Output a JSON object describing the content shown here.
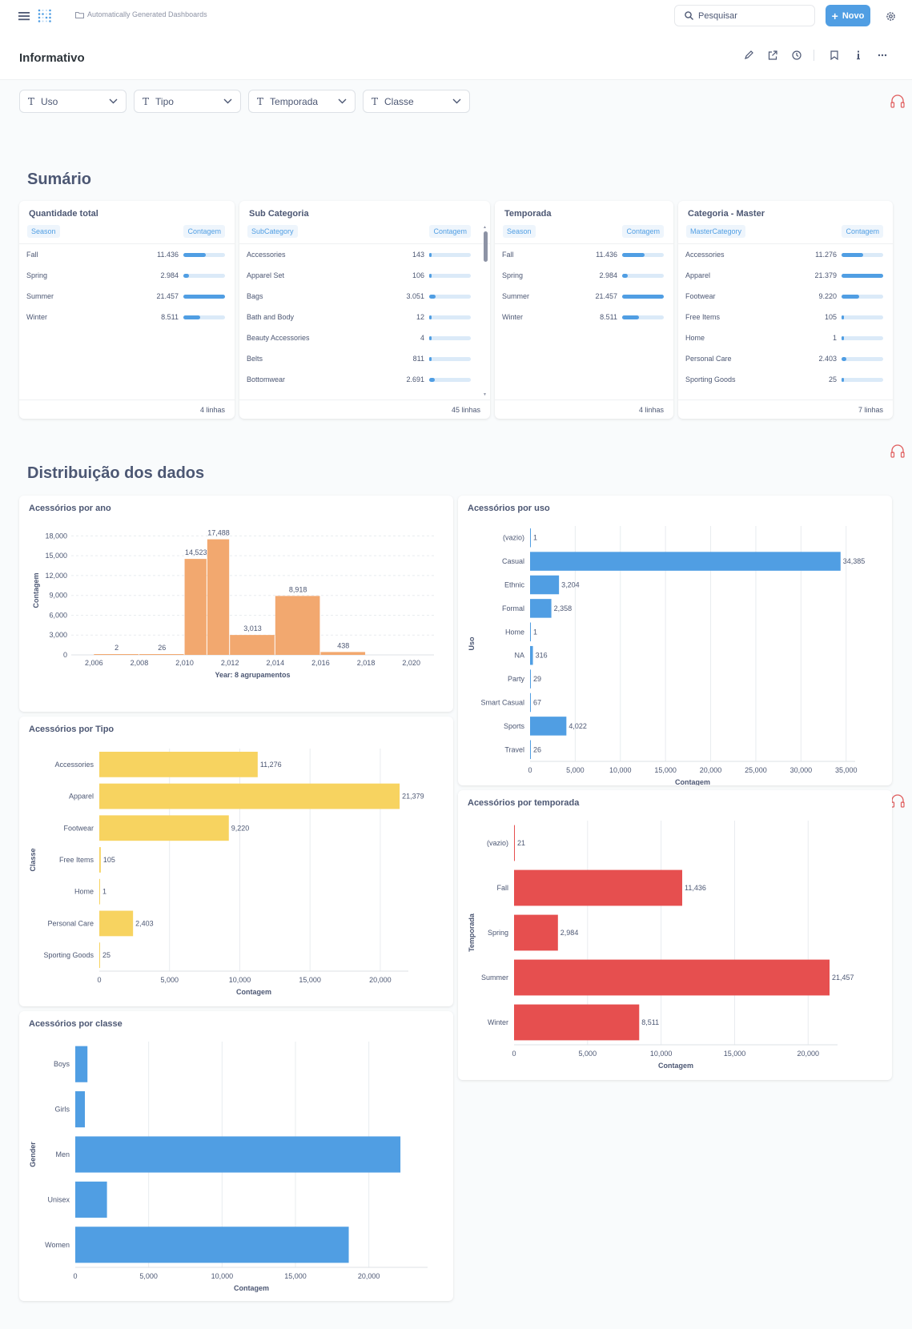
{
  "topbar": {
    "breadcrumb": "Automatically Generated Dashboards",
    "search_placeholder": "Pesquisar",
    "new_label": "Novo"
  },
  "dashboard": {
    "title": "Informativo"
  },
  "filters": [
    {
      "label": "Uso"
    },
    {
      "label": "Tipo"
    },
    {
      "label": "Temporada"
    },
    {
      "label": "Classe"
    }
  ],
  "sections": {
    "summary": "Sumário",
    "distribution": "Distribuição dos dados"
  },
  "tables": [
    {
      "title": "Quantidade total",
      "col1": "Season",
      "col2": "Contagem",
      "footer": "4 linhas",
      "max": 21457,
      "rows": [
        {
          "label": "Fall",
          "value": "11.436",
          "n": 11436
        },
        {
          "label": "Spring",
          "value": "2.984",
          "n": 2984
        },
        {
          "label": "Summer",
          "value": "21.457",
          "n": 21457
        },
        {
          "label": "Winter",
          "value": "8.511",
          "n": 8511
        }
      ]
    },
    {
      "title": "Sub Categoria",
      "col1": "SubCategory",
      "col2": "Contagem",
      "footer": "45 linhas",
      "max": 20000,
      "rows": [
        {
          "label": "Accessories",
          "value": "143",
          "n": 143
        },
        {
          "label": "Apparel Set",
          "value": "106",
          "n": 106
        },
        {
          "label": "Bags",
          "value": "3.051",
          "n": 3051
        },
        {
          "label": "Bath and Body",
          "value": "12",
          "n": 12
        },
        {
          "label": "Beauty Accessories",
          "value": "4",
          "n": 4
        },
        {
          "label": "Belts",
          "value": "811",
          "n": 811
        },
        {
          "label": "Bottomwear",
          "value": "2.691",
          "n": 2691
        }
      ]
    },
    {
      "title": "Temporada",
      "col1": "Season",
      "col2": "Contagem",
      "footer": "4 linhas",
      "max": 21457,
      "rows": [
        {
          "label": "Fall",
          "value": "11.436",
          "n": 11436
        },
        {
          "label": "Spring",
          "value": "2.984",
          "n": 2984
        },
        {
          "label": "Summer",
          "value": "21.457",
          "n": 21457
        },
        {
          "label": "Winter",
          "value": "8.511",
          "n": 8511
        }
      ]
    },
    {
      "title": "Categoria - Master",
      "col1": "MasterCategory",
      "col2": "Contagem",
      "footer": "7 linhas",
      "max": 21379,
      "rows": [
        {
          "label": "Accessories",
          "value": "11.276",
          "n": 11276
        },
        {
          "label": "Apparel",
          "value": "21.379",
          "n": 21379
        },
        {
          "label": "Footwear",
          "value": "9.220",
          "n": 9220
        },
        {
          "label": "Free Items",
          "value": "105",
          "n": 105
        },
        {
          "label": "Home",
          "value": "1",
          "n": 1
        },
        {
          "label": "Personal Care",
          "value": "2.403",
          "n": 2403
        },
        {
          "label": "Sporting Goods",
          "value": "25",
          "n": 25
        }
      ]
    }
  ],
  "chart_data": [
    {
      "id": "ano",
      "type": "bar",
      "title": "Acessórios por ano",
      "xlabel": "Year: 8 agrupamentos",
      "ylabel": "Contagem",
      "color": "#f2a86f",
      "bins": [
        {
          "x0": 2006,
          "x1": 2008,
          "value": 2
        },
        {
          "x0": 2008,
          "x1": 2010,
          "value": 26
        },
        {
          "x0": 2010,
          "x1": 2011,
          "value": 14523
        },
        {
          "x0": 2011,
          "x1": 2012,
          "value": 17488
        },
        {
          "x0": 2012,
          "x1": 2014,
          "value": 3013
        },
        {
          "x0": 2014,
          "x1": 2016,
          "value": 8918
        },
        {
          "x0": 2016,
          "x1": 2018,
          "value": 438
        }
      ],
      "labels": [
        "2",
        "26",
        "14,523",
        "17,488",
        "3,013",
        "8,918",
        "438"
      ],
      "xticks": [
        "2,006",
        "2,008",
        "2,010",
        "2,012",
        "2,014",
        "2,016",
        "2,018",
        "2,020"
      ],
      "yticks": [
        "0",
        "3,000",
        "6,000",
        "9,000",
        "12,000",
        "15,000",
        "18,000"
      ],
      "ylim": [
        0,
        19500
      ],
      "xlim": [
        2005,
        2021
      ]
    },
    {
      "id": "uso",
      "type": "bar",
      "orientation": "horizontal",
      "title": "Acessórios por uso",
      "xlabel": "Contagem",
      "ylabel": "Uso",
      "color": "#509ee3",
      "categories": [
        "(vazio)",
        "Casual",
        "Ethnic",
        "Formal",
        "Home",
        "NA",
        "Party",
        "Smart Casual",
        "Sports",
        "Travel"
      ],
      "values": [
        1,
        34385,
        3204,
        2358,
        1,
        316,
        29,
        67,
        4022,
        26
      ],
      "labels": [
        "1",
        "34,385",
        "3,204",
        "2,358",
        "1",
        "316",
        "29",
        "67",
        "4,022",
        "26"
      ],
      "xticks": [
        "0",
        "5,000",
        "10,000",
        "15,000",
        "20,000",
        "25,000",
        "30,000",
        "35,000"
      ],
      "xlim": [
        0,
        36000
      ]
    },
    {
      "id": "tipo",
      "type": "bar",
      "orientation": "horizontal",
      "title": "Acessórios por Tipo",
      "xlabel": "Contagem",
      "ylabel": "Classe",
      "color": "#f7d360",
      "categories": [
        "Accessories",
        "Apparel",
        "Footwear",
        "Free Items",
        "Home",
        "Personal Care",
        "Sporting Goods"
      ],
      "values": [
        11276,
        21379,
        9220,
        105,
        1,
        2403,
        25
      ],
      "labels": [
        "11,276",
        "21,379",
        "9,220",
        "105",
        "1",
        "2,403",
        "25"
      ],
      "xticks": [
        "0",
        "5,000",
        "10,000",
        "15,000",
        "20,000"
      ],
      "xlim": [
        0,
        22000
      ]
    },
    {
      "id": "temporada",
      "type": "bar",
      "orientation": "horizontal",
      "title": "Acessórios por temporada",
      "xlabel": "Contagem",
      "ylabel": "Temporada",
      "color": "#e64f4f",
      "categories": [
        "(vazio)",
        "Fall",
        "Spring",
        "Summer",
        "Winter"
      ],
      "values": [
        21,
        11436,
        2984,
        21457,
        8511
      ],
      "labels": [
        "21",
        "11,436",
        "2,984",
        "21,457",
        "8,511"
      ],
      "xticks": [
        "0",
        "5,000",
        "10,000",
        "15,000",
        "20,000"
      ],
      "xlim": [
        0,
        22000
      ]
    },
    {
      "id": "classe",
      "type": "bar",
      "orientation": "horizontal",
      "title": "Acessórios por classe",
      "xlabel": "Contagem",
      "ylabel": "Gender",
      "color": "#509ee3",
      "categories": [
        "Boys",
        "Girls",
        "Men",
        "Unisex",
        "Women"
      ],
      "values": [
        830,
        655,
        22150,
        2160,
        18630
      ],
      "labels": [],
      "xticks": [
        "0",
        "5,000",
        "10,000",
        "15,000",
        "20,000"
      ],
      "xlim": [
        0,
        24000
      ]
    }
  ]
}
